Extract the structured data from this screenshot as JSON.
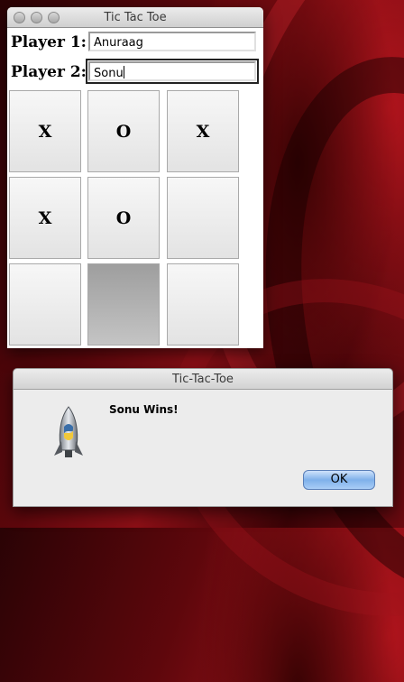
{
  "game_window": {
    "title": "Tic Tac Toe",
    "player1_label": "Player 1:",
    "player1_value": "Anuraag",
    "player2_label": "Player 2:",
    "player2_value": "Sonu",
    "board": [
      [
        "X",
        "O",
        "X"
      ],
      [
        "X",
        "O",
        ""
      ],
      [
        "",
        "",
        ""
      ]
    ]
  },
  "dialog": {
    "title": "Tic-Tac-Toe",
    "message": "Sonu Wins!",
    "ok_label": "OK",
    "icon": "python-rocket-icon"
  }
}
